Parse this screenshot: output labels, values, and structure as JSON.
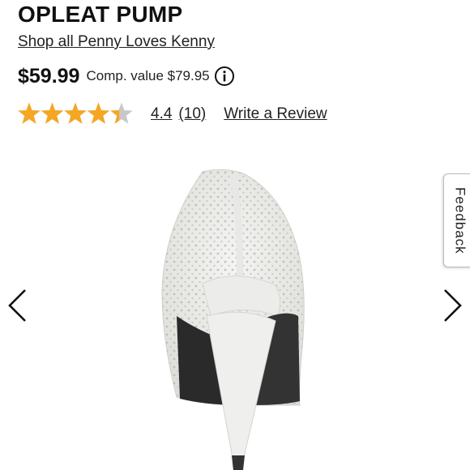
{
  "product": {
    "title": "OPLEAT PUMP",
    "brand_link": "Shop all Penny Loves Kenny",
    "price": "$59.99",
    "comp_value": "Comp. value $79.95",
    "rating": 4.4,
    "rating_text": "4.4",
    "review_count": "(10)",
    "write_review": "Write a Review"
  },
  "feedback": {
    "label": "Feedback"
  },
  "icons": {
    "info": "info-circle-icon",
    "prev": "chevron-left-icon",
    "next": "chevron-right-icon",
    "star": "star-icon"
  },
  "colors": {
    "star_fill": "#f5a623",
    "star_empty": "#c8c8c8",
    "text": "#111111"
  }
}
